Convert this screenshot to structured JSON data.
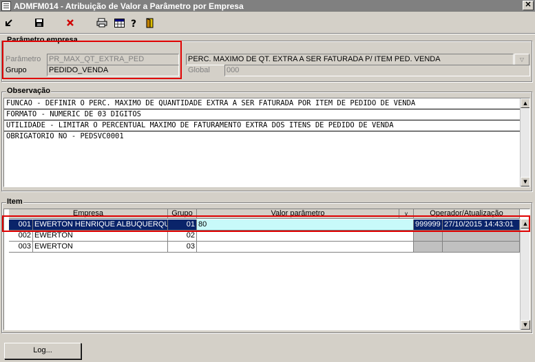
{
  "window": {
    "title": "ADMFM014 - Atribuição de Valor a Parâmetro por Empresa",
    "close": "✕"
  },
  "toolbar": {
    "icons": [
      "exit-icon",
      "save-icon",
      "delete-icon",
      "print-icon",
      "table-icon",
      "help-icon",
      "door-icon"
    ],
    "delete_color": "#d00000"
  },
  "parametro": {
    "legend": "Parâmetro empresa",
    "parametro_label": "Parâmetro",
    "parametro_value": "PR_MAX_QT_EXTRA_PED",
    "descricao_value": "PERC. MAXIMO DE QT. EXTRA A SER FATURADA P/ ITEM PED. VENDA",
    "grupo_label": "Grupo",
    "grupo_value": "PEDIDO_VENDA",
    "global_label": "Global",
    "global_value": "000"
  },
  "observacao": {
    "legend": "Observação",
    "lines": [
      "FUNCAO - DEFINIR O PERC. MAXIMO DE QUANTIDADE EXTRA A SER FATURADA POR ITEM DE PEDIDO DE VENDA",
      "FORMATO - NUMERIC DE 03 DIGITOS",
      "UTILIDADE - LIMITAR O PERCENTUAL MAXIMO DE FATURAMENTO EXTRA DOS ITENS DE PEDIDO DE VENDA",
      "OBRIGATORIO NO - PEDSVC0001"
    ]
  },
  "item": {
    "legend": "Item",
    "headers": {
      "empresa": "Empresa",
      "grupo": "Grupo",
      "valor": "Valor parâmetro",
      "dropdown": "v",
      "operador": "Operador/Atualização"
    },
    "rows": [
      {
        "cod": "001",
        "nome": "EWERTON HENRIQUE ALBUQUERQUE D",
        "grupo": "01",
        "valor": "80",
        "operador": "999999",
        "data": "27/10/2015 14:43:01"
      },
      {
        "cod": "002",
        "nome": "EWERTON",
        "grupo": "02",
        "valor": "",
        "operador": "",
        "data": ""
      },
      {
        "cod": "003",
        "nome": "EWERTON",
        "grupo": "03",
        "valor": "",
        "operador": "",
        "data": ""
      }
    ]
  },
  "buttons": {
    "log": "Log..."
  },
  "colors": {
    "highlight": "#e00000",
    "selection": "#0a246a",
    "edit": "#c8fafa"
  }
}
